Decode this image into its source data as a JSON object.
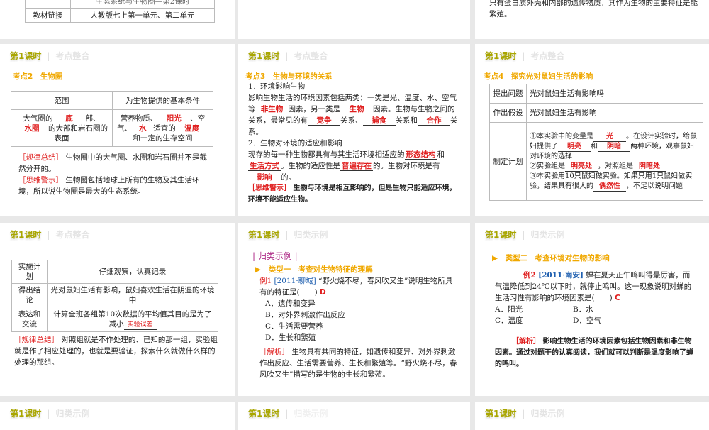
{
  "header": {
    "lesson": "第1课时",
    "sec_review": "考点整合",
    "sec_examples": "归类示例"
  },
  "top": {
    "row_a": "生态系统与生物圈—第2课时",
    "row_b_label": "教材链接",
    "row_b_value": "人教版七上第一单元、第二单元",
    "right_text": "只有蛋白质外壳和内部的遗传物质，其作为生物的主要特征是能繁殖。"
  },
  "s2": {
    "heading": "考点2　生物圈",
    "th1": "范围",
    "th2": "为生物提供的基本条件",
    "c1a": "大气圈的",
    "c1_ans1": "底",
    "c1b": "部、",
    "c1_ans2": "水圈",
    "c1c": "的大部和岩石圈的表面",
    "c2a": "营养物质、",
    "c2_ans1": "阳光",
    "c2b": "、空气、",
    "c2_ans2": "水",
    "c2c": "适宜的",
    "c2_ans3": "温度",
    "c2d": "和一定的生存空间",
    "tag1": "［规律总结］",
    "note1": "生物圈中的大气圈、水圈和岩石圈并不是截然分开的。",
    "tag2": "［思维警示］",
    "note2": "生物圈包括地球上所有的生物及其生活环境，所以说生物圈是最大的生态系统。"
  },
  "s3": {
    "heading": "考点3　生物与环境的关系",
    "p1": "1．环境影响生物",
    "p2a": "影响生物生活的环境因素包括两类：一类是光、温度、水、空气等",
    "a1": "非生物",
    "p2b": "因素，另一类是",
    "a2": "生物",
    "p2c": "因素。生物与生物之间的关系，最常见的有",
    "a3": "竞争",
    "p2d": "关系、",
    "a4": "捕食",
    "p2e": "关系和",
    "a5": "合作",
    "p2f": "关系。",
    "p3": "2．生物对环境的适应和影响",
    "p4a": "现存的每一种生物都具有与其生活环境相适应的",
    "a6": "形态结构",
    "p4b": "和",
    "a7": "生活方式",
    "p4c": "。生物的适应性是",
    "a8": "普遍存在",
    "p4d": "的。生物对环境是有",
    "a9": "影响",
    "p4e": "的。",
    "tag": "［思维警示］",
    "warn": "生物与环境是相互影响的，但是生物只能适应环境，环境不能适应生物。"
  },
  "s4": {
    "heading": "考点4　探究光对鼠妇生活的影响",
    "r1l": "提出问题",
    "r1v": "光对鼠妇生活有影响吗",
    "r2l": "作出假设",
    "r2v": "光对鼠妇生活有影响",
    "r3l": "制定计划",
    "p1a": "①本实验中的变量是",
    "a1": "光",
    "p1b": "。在设计实验时，给鼠妇提供了",
    "a2": "明亮",
    "p1c": "和",
    "a3": "阴暗",
    "p1d": "两种环境，观察鼠妇对环境的选择",
    "p2a": "②实验组是",
    "a4": "明亮处",
    "p2b": "，对照组是",
    "a5": "阴暗处",
    "p3a": "③本实验用10只鼠妇做实验。如果只用1只鼠妇做实验，结果具有很大的",
    "a6": "偶然性",
    "p3b": "，不足以说明问题"
  },
  "s5": {
    "r1l": "实施计划",
    "r1v": "仔细观察，认真记录",
    "r2l": "得出结论",
    "r2v": "光对鼠妇生活有影响，鼠妇喜欢生活在阴湿的环境中",
    "r3l": "表达和交流",
    "r3v": "计算全班各组第10次数据的平均值其目的是为了减小",
    "a1": "实验误差",
    "tag": "［规律总结］",
    "note": "对照组就是不作处理的、已知的那一组，实验组就是作了相应处理的，也就是要验证，探索什么就做什么样的处理的那组。"
  },
  "s6": {
    "title": "| 归类示例 |",
    "type": "▶　类型一　考查对生物特征的理解",
    "ex": "例1",
    "src": "[2011·聊城]",
    "q": "“野火烧不尽，春风吹又生”说明生物所具有的特征是(　　)",
    "ans": "D",
    "opts": [
      "A．遗传和变异",
      "B．对外界刺激作出反应",
      "C．生活需要营养",
      "D．生长和繁殖"
    ],
    "tag": "［解析］",
    "analysis": "生物具有共同的特征，如遗传和变异、对外界刺激作出反应、生活需要营养、生长和繁殖等。“野火烧不尽，春风吹又生”描写的是生物的生长和繁殖。"
  },
  "s7": {
    "type": "▶　类型二　考查环境对生物的影响",
    "ex": "例2",
    "src": "[2011·南安]",
    "q": "蝉在夏天正午鸣叫得最厉害，而气温降低到24℃以下时，就停止鸣叫。这一现象说明对蝉的生活习性有影响的环境因素是(　　)",
    "ans": "C",
    "opts": [
      "A．阳光",
      "B．水",
      "C．温度",
      "D．空气"
    ],
    "tag": "［解析］",
    "analysis": "影响生物生活的环境因素包括生物因素和非生物因素。通过对题干的认真阅读，我们就可以判断是温度影响了蝉的鸣叫。"
  }
}
